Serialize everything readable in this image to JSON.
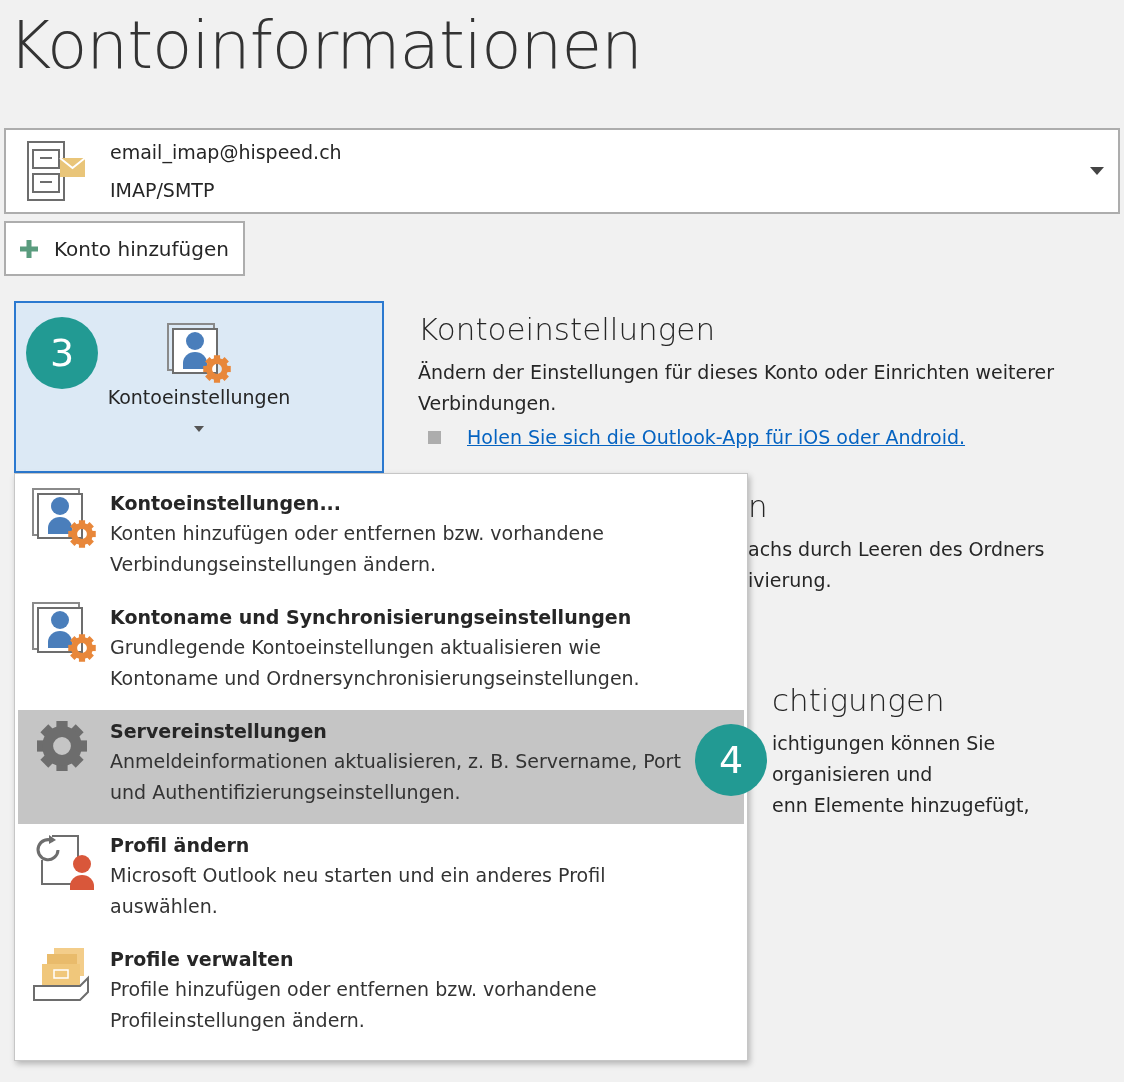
{
  "page": {
    "title": "Kontoinformationen"
  },
  "account": {
    "email": "email_imap@hispeed.ch",
    "type": "IMAP/SMTP"
  },
  "add_account_button": {
    "label": "Konto hinzufügen"
  },
  "account_settings_button": {
    "label": "Kontoeinstellungen",
    "pressed": true,
    "callout": "3"
  },
  "sections": [
    {
      "heading": "Kontoeinstellungen",
      "description": "Ändern der Einstellungen für dieses Konto oder Einrichten weiterer Verbindungen.",
      "link": "Holen Sie sich die Outlook-App für iOS oder Android."
    },
    {
      "heading": "n",
      "lines": [
        "achs durch Leeren des Ordners",
        "ivierung."
      ]
    },
    {
      "heading": "chtigungen",
      "lines": [
        "ichtigungen können Sie",
        "organisieren und",
        "enn Elemente hinzugefügt,"
      ]
    }
  ],
  "menu": {
    "callout": "4",
    "items": [
      {
        "kind": "account-settings",
        "title": "Kontoeinstellungen...",
        "description": "Konten hinzufügen oder entfernen bzw. vorhandene Verbindungseinstellungen ändern.",
        "selected": false
      },
      {
        "kind": "account-settings",
        "title": "Kontoname und Synchronisierungseinstellungen",
        "description": "Grundlegende Kontoeinstellungen aktualisieren wie Kontoname und Ordnersynchronisierungseinstellungen.",
        "selected": false
      },
      {
        "kind": "gear",
        "title": "Servereinstellungen",
        "description": "Anmeldeinformationen aktualisieren, z. B. Servername, Port und Authentifizierungseinstellungen.",
        "selected": true
      },
      {
        "kind": "profile-change",
        "title": "Profil ändern",
        "description": "Microsoft Outlook neu starten und ein anderes Profil auswählen.",
        "selected": false
      },
      {
        "kind": "profile-manage",
        "title": "Profile verwalten",
        "description": "Profile hinzufügen oder entfernen bzw. vorhandene Profileinstellungen ändern.",
        "selected": false
      }
    ]
  }
}
